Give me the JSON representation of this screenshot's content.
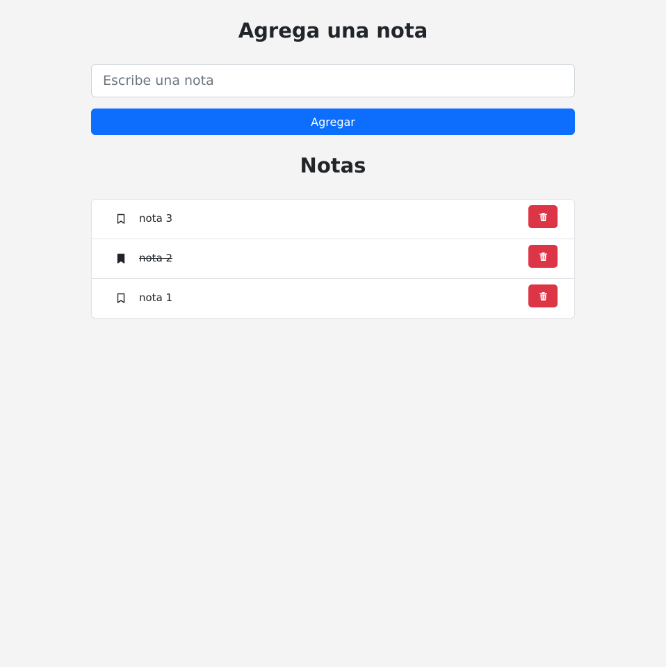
{
  "header": {
    "title": "Agrega una nota"
  },
  "form": {
    "placeholder": "Escribe una nota",
    "value": "",
    "submit_label": "Agregar"
  },
  "list": {
    "title": "Notas",
    "items": [
      {
        "text": "nota 3",
        "done": false,
        "icon": "bookmark-outline-icon"
      },
      {
        "text": "nota 2",
        "done": true,
        "icon": "bookmark-filled-icon"
      },
      {
        "text": "nota 1",
        "done": false,
        "icon": "bookmark-outline-icon"
      }
    ],
    "delete_icon": "trash-icon"
  },
  "colors": {
    "primary": "#0d6efd",
    "danger": "#dc3545",
    "background": "#f4f4f4",
    "text": "#212529"
  }
}
